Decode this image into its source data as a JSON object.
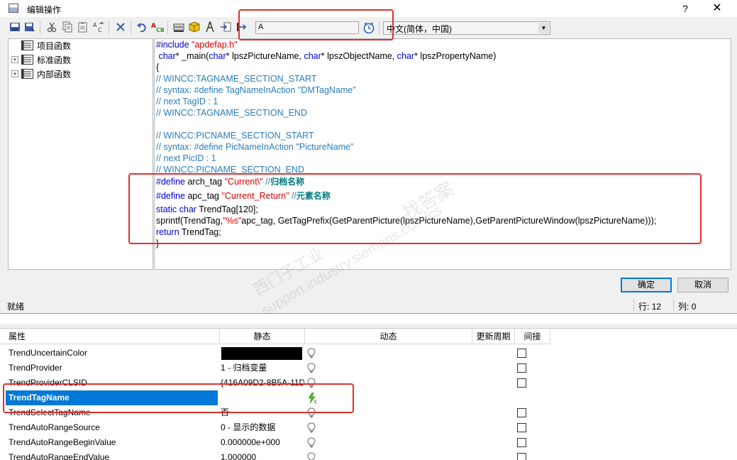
{
  "window": {
    "title": "编辑操作",
    "help_label": "?",
    "close_label": "✕"
  },
  "toolbar": {
    "search_value": "A",
    "language": "中文(简体，中国)"
  },
  "tree": {
    "items": [
      {
        "label": "项目函数",
        "expandable": false
      },
      {
        "label": "标准函数",
        "expandable": true
      },
      {
        "label": "内部函数",
        "expandable": true
      }
    ]
  },
  "code": {
    "l01_a": "#include ",
    "l01_b": "\"apdefap.h\"",
    "l02_a": " char",
    "l02_b": "* _main(",
    "l02_c": "char",
    "l02_d": "* lpszPictureName, ",
    "l02_e": "char",
    "l02_f": "* lpszObjectName, ",
    "l02_g": "char",
    "l02_h": "* lpszPropertyName)",
    "l03": "{",
    "l04": "// WINCC:TAGNAME_SECTION_START",
    "l05": "// syntax: #define TagNameInAction \"DMTagName\"",
    "l06": "// next TagID : 1",
    "l07": "// WINCC:TAGNAME_SECTION_END",
    "l08": "// WINCC:PICNAME_SECTION_START",
    "l09": "// syntax: #define PicNameInAction \"PictureName\"",
    "l10": "// next PicID : 1",
    "l11": "// WINCC:PICNAME_SECTION_END",
    "l12_a": "#define ",
    "l12_b": "arch_tag ",
    "l12_c": "\"Current\\\"",
    "l12_d": " //",
    "l12_e": "归档名称",
    "l13_a": "#define ",
    "l13_b": "apc_tag ",
    "l13_c": "\"Current_Return\"",
    "l13_d": " //",
    "l13_e": "元素名称",
    "l14_a": "static ",
    "l14_b": "char ",
    "l14_c": "TrendTag[120];",
    "l15_a": "sprintf(TrendTag,",
    "l15_b": "\"%s\"",
    "l15_c": "apc_tag, GetTagPrefix(GetParentPicture(lpszPictureName),GetParentPictureWindow(lpszPictureName)));",
    "l16_a": "return ",
    "l16_b": "TrendTag;",
    "l17": "}"
  },
  "buttons": {
    "ok": "确定",
    "cancel": "取消"
  },
  "status": {
    "left": "就绪",
    "row_label": "行:",
    "row_value": "12",
    "col_label": "列:",
    "col_value": "0"
  },
  "grid": {
    "headers": {
      "property": "属性",
      "static": "静态",
      "dynamic": "动态",
      "update_cycle": "更新周期",
      "indirect": "间接"
    },
    "rows": [
      {
        "name": "TrendUncertainColor",
        "static": ""
      },
      {
        "name": "TrendProvider",
        "static": "1 - 归档变量"
      },
      {
        "name": "TrendProviderCLSID",
        "static": "{416A09D2-8B5A-11D"
      },
      {
        "name": "TrendTagName",
        "static": ""
      },
      {
        "name": "TrendSelectTagName",
        "static": "否"
      },
      {
        "name": "TrendAutoRangeSource",
        "static": "0 - 显示的数据"
      },
      {
        "name": "TrendAutoRangeBeginValue",
        "static": "0.000000e+000"
      },
      {
        "name": "TrendAutoRangeEndValue",
        "static": "1.000000"
      }
    ]
  },
  "watermark": {
    "line1": "西门子工业",
    "line2": "找答案",
    "line3": "support.industry.siemens.com/cs"
  },
  "colors": {
    "selection": "#0078d7",
    "annotation": "#e0312e",
    "accent": "#0078d7"
  }
}
